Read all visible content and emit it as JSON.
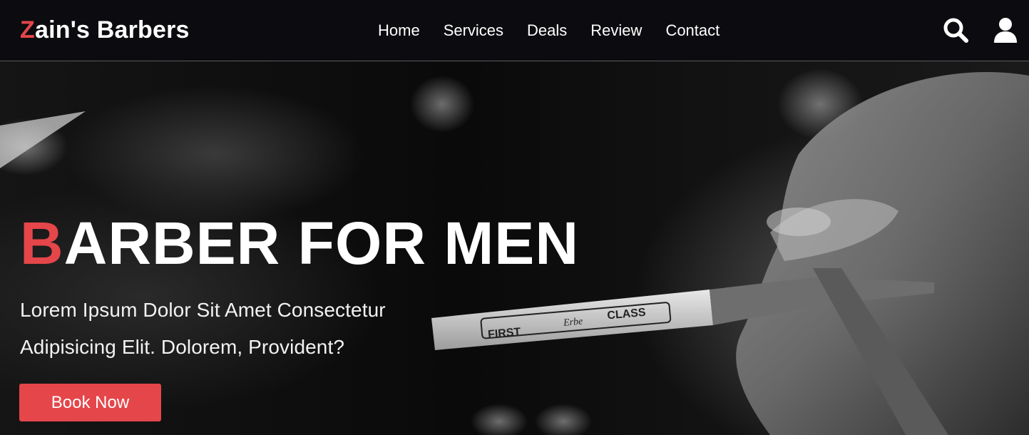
{
  "brand": {
    "first_letter": "Z",
    "rest": "ain's Barbers",
    "accent_color": "#e4464a"
  },
  "nav": {
    "items": [
      {
        "label": "Home"
      },
      {
        "label": "Services"
      },
      {
        "label": "Deals"
      },
      {
        "label": "Review"
      },
      {
        "label": "Contact"
      }
    ]
  },
  "header_icons": {
    "search": "search-icon",
    "user": "user-icon"
  },
  "hero": {
    "title_first_letter": "B",
    "title_rest": "ARBER FOR MEN",
    "subtitle_line1": "Lorem Ipsum Dolor Sit Amet Consectetur",
    "subtitle_line2": "Adipisicing Elit. Dolorem, Provident?",
    "cta_label": "Book Now",
    "razor_text_left": "FIRST",
    "razor_text_mid": "Erbe",
    "razor_text_right": "CLASS"
  }
}
